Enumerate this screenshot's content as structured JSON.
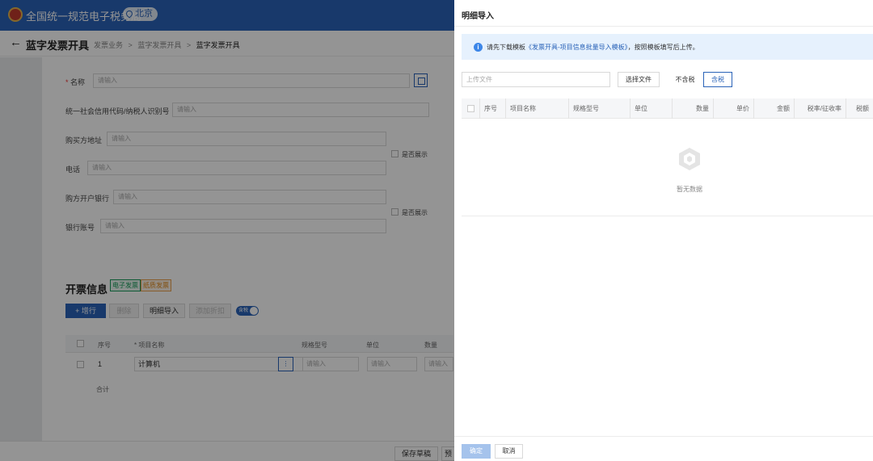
{
  "header": {
    "site_title": "全国统一规范电子税务局",
    "region": "北京"
  },
  "titlebar": {
    "back": "←",
    "page_title": "蓝字发票开具",
    "breadcrumbs": [
      "发票业务",
      ">",
      "蓝字发票开具",
      ">",
      "蓝字发票开具"
    ]
  },
  "form": {
    "name_required": "*",
    "name_label": "名称",
    "name_placeholder": "请输入",
    "credit_code_label": "统一社会信用代码/纳税人识别号",
    "credit_code_placeholder": "请输入",
    "address_label": "购买方地址",
    "address_placeholder": "请输入",
    "phone_label": "电话",
    "phone_placeholder": "请输入",
    "show_label_1": "是否展示",
    "bank_label": "购方开户银行",
    "bank_placeholder": "请输入",
    "account_label": "银行账号",
    "account_placeholder": "请输入",
    "show_label_2": "是否展示"
  },
  "invoice_info": {
    "title": "开票信息",
    "tag_electronic": "电子发票",
    "tag_paper": "纸质发票",
    "add_row": "+ 增行",
    "delete": "删除",
    "detail_import": "明细导入",
    "add_discount": "添加折扣",
    "tax_toggle": "含税",
    "columns": [
      "序号",
      "* 项目名称",
      "规格型号",
      "单位",
      "数量"
    ],
    "row": {
      "index": "1",
      "item_name": "计算机",
      "more": "⋮",
      "spec_placeholder": "请输入",
      "unit_placeholder": "请输入",
      "qty_placeholder": "请输入"
    },
    "total_label": "合计"
  },
  "bottom": {
    "save_draft": "保存草稿",
    "preview_partial": "预"
  },
  "drawer": {
    "title": "明细导入",
    "notice_prefix": "请先下载模板",
    "notice_link": "《发票开具-项目信息批量导入模板》",
    "notice_suffix": "，按照模板填写后上传。",
    "info_icon": "i",
    "upload_placeholder": "上传文件",
    "choose_file": "选择文件",
    "tax_excluded": "不含税",
    "tax_included": "含税",
    "columns": [
      "序号",
      "项目名称",
      "规格型号",
      "单位",
      "数量",
      "单价",
      "金额",
      "税率/征收率",
      "税额"
    ],
    "empty_text": "暂无数据",
    "confirm": "确定",
    "cancel": "取消"
  },
  "colors": {
    "primary": "#2a63b8",
    "notice_bg": "#e6f1fd",
    "overlay": "rgba(0,0,0,0.42)"
  }
}
